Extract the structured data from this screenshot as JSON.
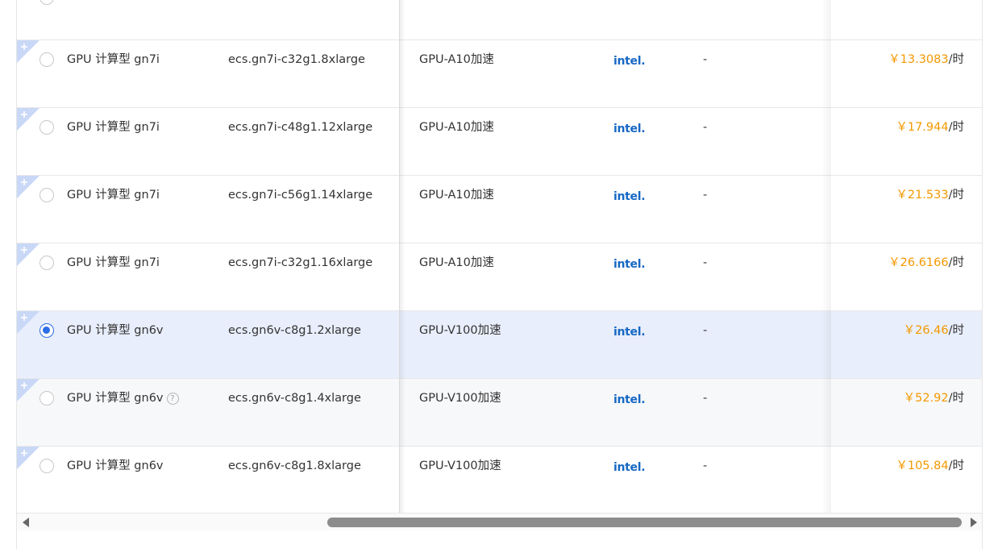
{
  "rows": [
    {
      "family": "GPU 计算型 gn7i",
      "spec": "ecs.gn7i-c32g1.8xlarge",
      "gpu": "GPU-A10加速",
      "cpu_brand": "intel.",
      "extra": "-",
      "price": "￥13.3083",
      "unit": "/时",
      "selected": false,
      "help": false
    },
    {
      "family": "GPU 计算型 gn7i",
      "spec": "ecs.gn7i-c48g1.12xlarge",
      "gpu": "GPU-A10加速",
      "cpu_brand": "intel.",
      "extra": "-",
      "price": "￥17.944",
      "unit": "/时",
      "selected": false,
      "help": false
    },
    {
      "family": "GPU 计算型 gn7i",
      "spec": "ecs.gn7i-c56g1.14xlarge",
      "gpu": "GPU-A10加速",
      "cpu_brand": "intel.",
      "extra": "-",
      "price": "￥21.533",
      "unit": "/时",
      "selected": false,
      "help": false
    },
    {
      "family": "GPU 计算型 gn7i",
      "spec": "ecs.gn7i-c32g1.16xlarge",
      "gpu": "GPU-A10加速",
      "cpu_brand": "intel.",
      "extra": "-",
      "price": "￥26.6166",
      "unit": "/时",
      "selected": false,
      "help": false
    },
    {
      "family": "GPU 计算型 gn6v",
      "spec": "ecs.gn6v-c8g1.2xlarge",
      "gpu": "GPU-V100加速",
      "cpu_brand": "intel.",
      "extra": "-",
      "price": "￥26.46",
      "unit": "/时",
      "selected": true,
      "help": false
    },
    {
      "family": "GPU 计算型 gn6v",
      "spec": "ecs.gn6v-c8g1.4xlarge",
      "gpu": "GPU-V100加速",
      "cpu_brand": "intel.",
      "extra": "-",
      "price": "￥52.92",
      "unit": "/时",
      "selected": false,
      "help": true
    },
    {
      "family": "GPU 计算型 gn6v",
      "spec": "ecs.gn6v-c8g1.8xlarge",
      "gpu": "GPU-V100加速",
      "cpu_brand": "intel.",
      "extra": "-",
      "price": "￥105.84",
      "unit": "/时",
      "selected": false,
      "help": false
    }
  ],
  "help_glyph": "?",
  "colors": {
    "accent": "#2e6de6",
    "price": "#f39800",
    "selected_row": "#e8eefb",
    "intel": "#1768c4"
  }
}
